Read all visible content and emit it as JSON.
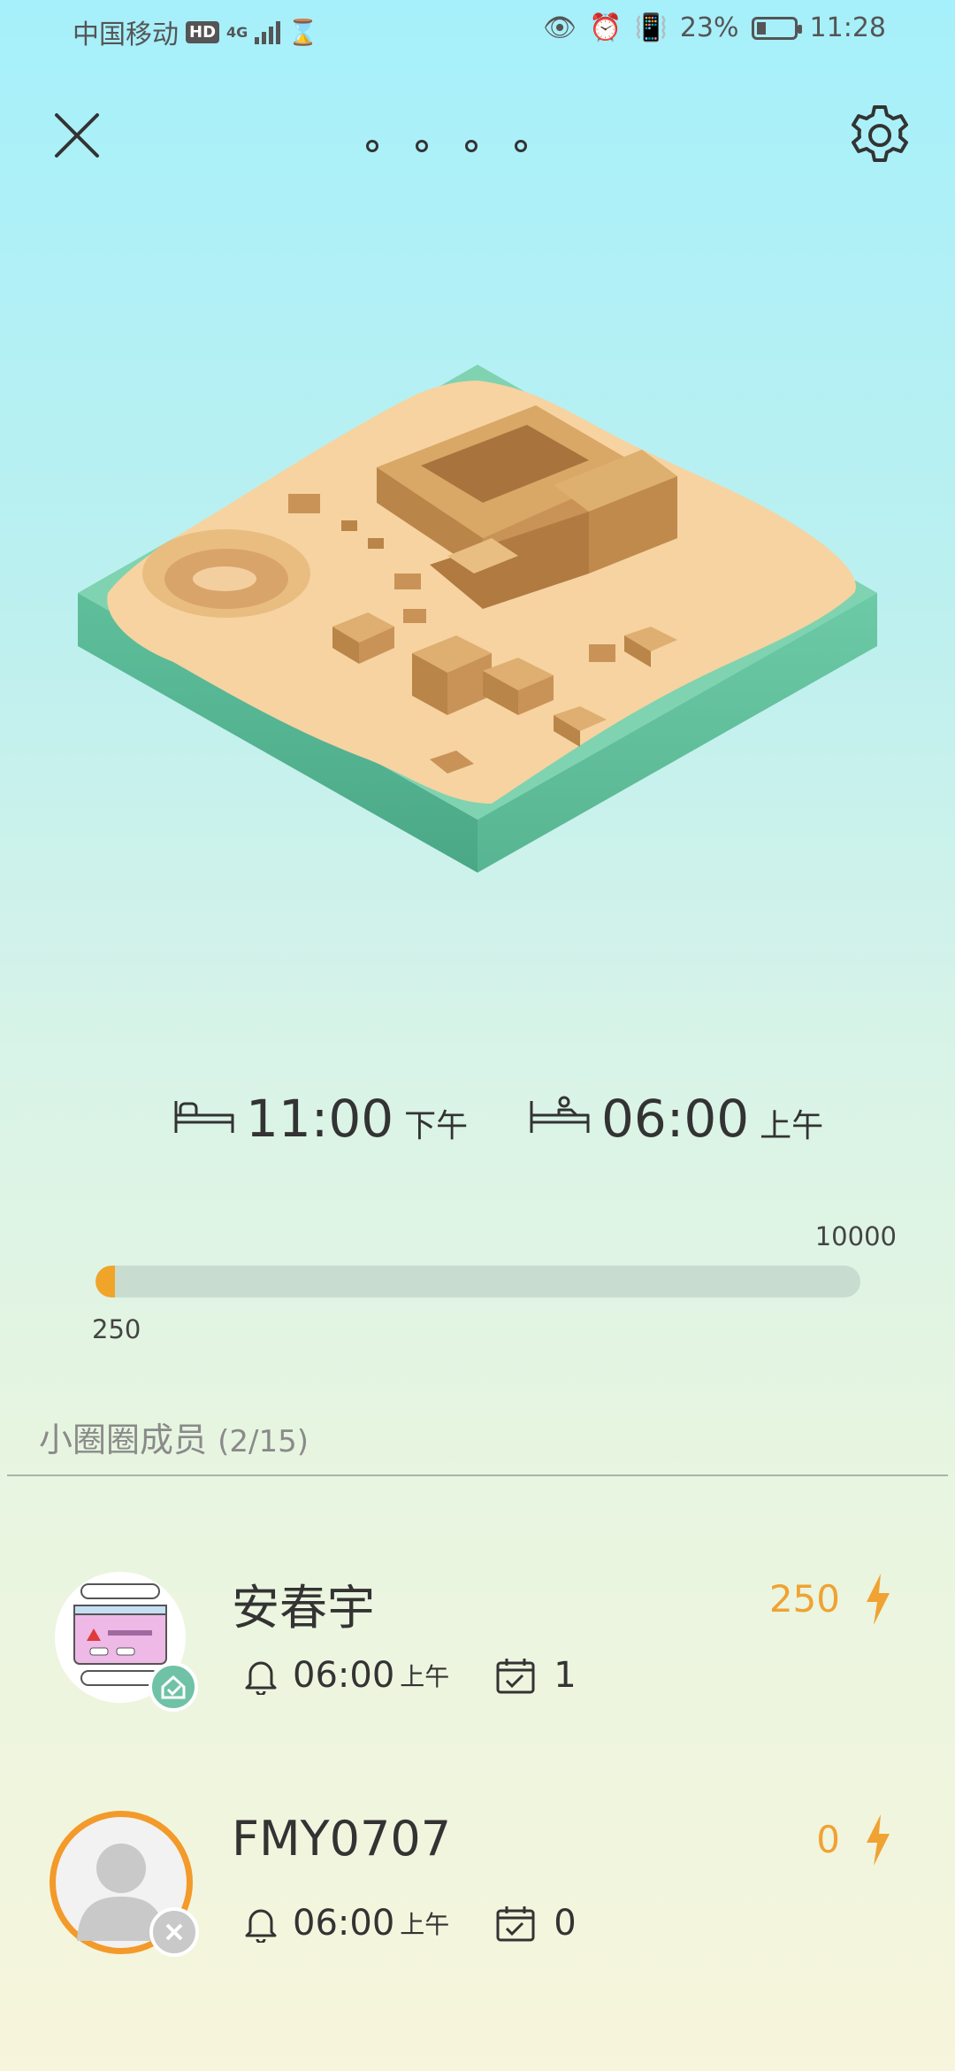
{
  "status_bar": {
    "carrier": "中国移动",
    "hd": "HD",
    "network": "4G",
    "battery": "23%",
    "time": "11:28"
  },
  "header": {
    "page_dots": 4
  },
  "schedule": {
    "sleep_time": "11:00",
    "sleep_period": "下午",
    "wake_time": "06:00",
    "wake_period": "上午"
  },
  "progress": {
    "current": 250,
    "max": 10000,
    "current_label": "250",
    "max_label": "10000",
    "fill_fraction": 0.025,
    "color": "#f0a52a"
  },
  "members": {
    "title": "小圈圈成员",
    "count": "(2/15)",
    "items": [
      {
        "name": "安春宇",
        "score": "250",
        "time": "06:00",
        "period": "上午",
        "checkins": "1",
        "status": "checked"
      },
      {
        "name": "FMY0707",
        "score": "0",
        "time": "06:00",
        "period": "上午",
        "checkins": "0",
        "status": "absent"
      }
    ]
  },
  "colors": {
    "accent_orange": "#f0a233",
    "status_ok": "#6fc2a5",
    "status_absent": "#c9c9c9"
  },
  "icons": [
    "close-icon",
    "gear-icon",
    "bed-icon",
    "wake-bed-icon",
    "bell-icon",
    "calendar-check-icon",
    "lightning-icon",
    "check-badge-icon",
    "x-badge-icon",
    "person-icon"
  ]
}
